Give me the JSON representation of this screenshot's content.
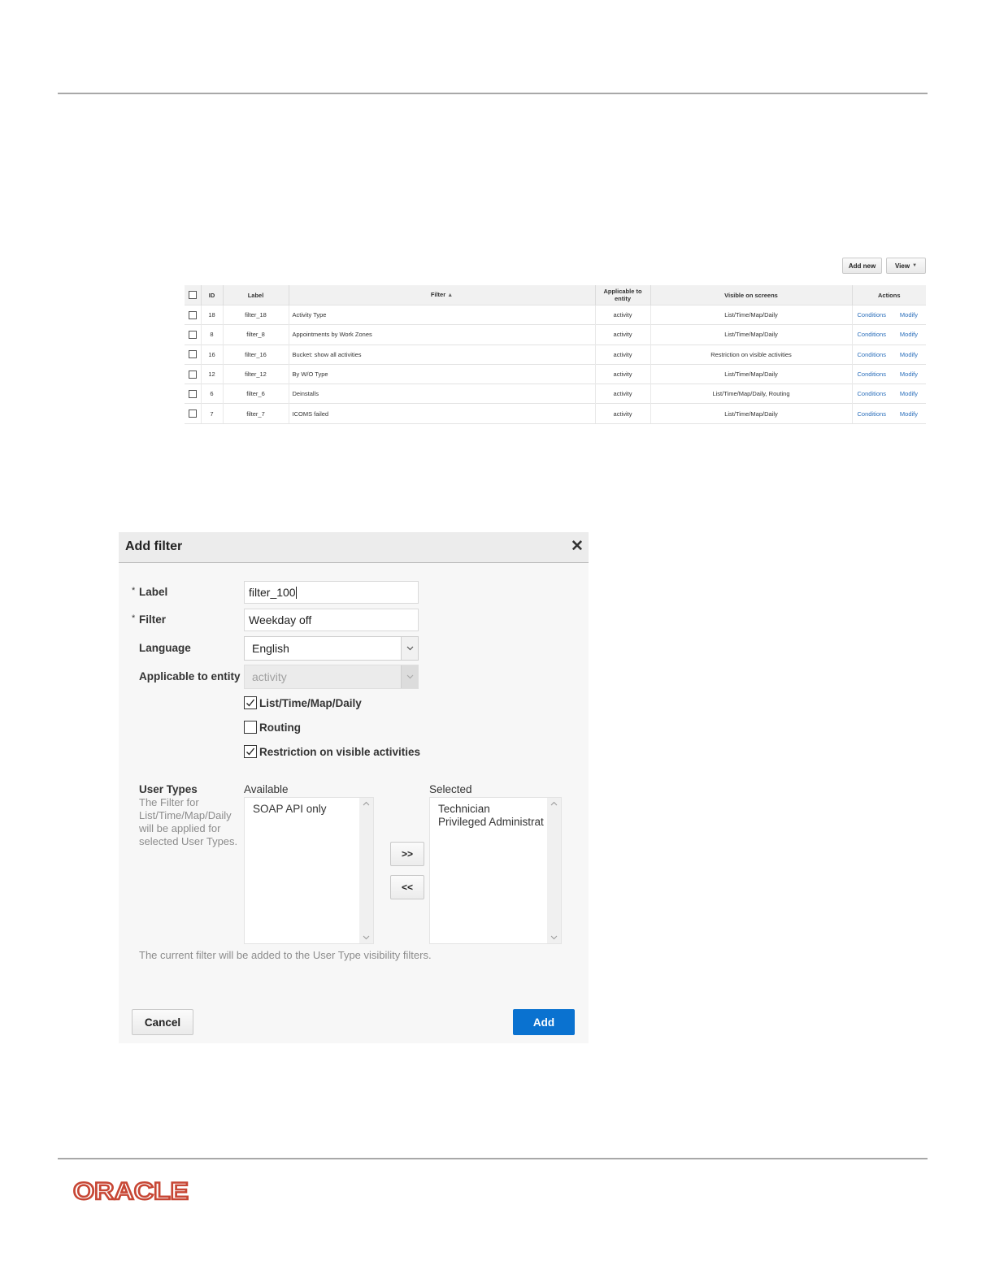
{
  "toolbar": {
    "add_new_label": "Add new",
    "view_label": "View"
  },
  "table": {
    "headers": {
      "id": "ID",
      "label": "Label",
      "filter": "Filter",
      "applicable_to_entity": "Applicable to entity",
      "visible_on_screens": "Visible on screens",
      "actions": "Actions"
    },
    "sort": {
      "column": "Filter",
      "direction": "ascending"
    },
    "rows": [
      {
        "id": "18",
        "label": "filter_18",
        "filter": "Activity Type",
        "entity": "activity",
        "screens": "List/Time/Map/Daily",
        "action1": "Conditions",
        "action2": "Modify"
      },
      {
        "id": "8",
        "label": "filter_8",
        "filter": "Appointments by Work Zones",
        "entity": "activity",
        "screens": "List/Time/Map/Daily",
        "action1": "Conditions",
        "action2": "Modify"
      },
      {
        "id": "16",
        "label": "filter_16",
        "filter": "Bucket: show all activities",
        "entity": "activity",
        "screens": "Restriction on visible activities",
        "action1": "Conditions",
        "action2": "Modify"
      },
      {
        "id": "12",
        "label": "filter_12",
        "filter": "By W/O Type",
        "entity": "activity",
        "screens": "List/Time/Map/Daily",
        "action1": "Conditions",
        "action2": "Modify"
      },
      {
        "id": "6",
        "label": "filter_6",
        "filter": "Deinstalls",
        "entity": "activity",
        "screens": "List/Time/Map/Daily, Routing",
        "action1": "Conditions",
        "action2": "Modify"
      },
      {
        "id": "7",
        "label": "filter_7",
        "filter": "ICOMS failed",
        "entity": "activity",
        "screens": "List/Time/Map/Daily",
        "action1": "Conditions",
        "action2": "Modify"
      }
    ]
  },
  "dialog": {
    "title": "Add filter",
    "required_mark": "*",
    "fields": {
      "label": {
        "label": "Label",
        "value": "filter_100"
      },
      "filter": {
        "label": "Filter",
        "value": "Weekday off"
      },
      "language": {
        "label": "Language",
        "value": "English"
      },
      "entity": {
        "label": "Applicable to entity",
        "value": "activity"
      }
    },
    "checkboxes": [
      {
        "label": "List/Time/Map/Daily",
        "checked": true
      },
      {
        "label": "Routing",
        "checked": false
      },
      {
        "label": "Restriction on visible activities",
        "checked": true
      }
    ],
    "user_types": {
      "title": "User Types",
      "description": "The Filter for List/Time/Map/Daily will be applied for selected User Types.",
      "available_label": "Available",
      "selected_label": "Selected",
      "available": [
        "SOAP API only"
      ],
      "selected": [
        "Technician",
        "Privileged Administrat"
      ],
      "move_right": ">>",
      "move_left": "<<"
    },
    "note": "The current filter will be added to the User Type visibility filters.",
    "cancel_label": "Cancel",
    "add_label": "Add"
  },
  "footer": {
    "logo_text": "ORACLE",
    "logo_color": "#c74634"
  },
  "colors": {
    "link": "#2a6ebb",
    "primary_button": "#0a72d0"
  }
}
